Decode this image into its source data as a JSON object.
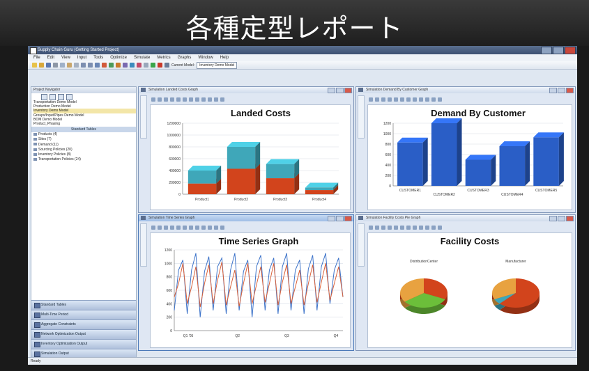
{
  "hero": {
    "title": "各種定型レポート"
  },
  "window": {
    "title": "Supply Chain Guru (Getting Started Project)"
  },
  "menu": [
    "File",
    "Edit",
    "View",
    "Input",
    "Tools",
    "Optimize",
    "Simulate",
    "Metrics",
    "Graphs",
    "Window",
    "Help"
  ],
  "toolbar": {
    "current_model_label": "Current Model:",
    "current_model_value": "Inventory Demo Model"
  },
  "navigator": {
    "title": "Project Navigator",
    "models": [
      "Transportation Demo Model",
      "Production Demo Model",
      "Inventory Demo Model",
      "Groups/Input/Pipes Demo Model",
      "BOM Demo Model",
      "Product_Phasing"
    ],
    "selected_index": 2,
    "standard_tables_label": "Standard Tables",
    "tables": [
      "Products (4)",
      "Sites (7)",
      "Demand (11)",
      "Sourcing Policies (20)",
      "Inventory Policies (8)",
      "Transportation Policies (24)"
    ],
    "buttons": [
      "Standard Tables",
      "Multi-Time Period",
      "Aggregate Constraints",
      "Network Optimization Output",
      "Inventory Optimization Output",
      "Simulation Output"
    ]
  },
  "windows": {
    "landed": {
      "title": "Simulation Landed Costs Graph"
    },
    "demand": {
      "title": "Simulation Demand By Customer Graph"
    },
    "timeseries": {
      "title": "Simulation Time Series Graph"
    },
    "facility": {
      "title": "Simulation Facility Costs Pie Graph"
    }
  },
  "status": "Ready",
  "colors": {
    "teal": "#3fa7b9",
    "red": "#d2441c",
    "blue": "#2a5ec6",
    "orange": "#e8a240",
    "green": "#6cbf3a"
  },
  "chart_data": [
    {
      "type": "bar",
      "title": "Landed Costs",
      "categories": [
        "Product1",
        "Product2",
        "Product3",
        "Product4"
      ],
      "series": [
        {
          "values": [
            180000,
            430000,
            270000,
            70000
          ]
        },
        {
          "values": [
            220000,
            370000,
            240000,
            40000
          ]
        }
      ],
      "yticks": [
        "0",
        "200000",
        "400000",
        "600000",
        "800000",
        "1000000",
        "1200000"
      ],
      "ylim": [
        0,
        1200000
      ],
      "grid": true
    },
    {
      "type": "bar",
      "title": "Demand By Customer",
      "categories": [
        "CUSTOMER1",
        "CUSTOMER2",
        "CUSTOMER3",
        "CUSTOMER4",
        "CUSTOMER5"
      ],
      "values": [
        830,
        1200,
        500,
        760,
        930
      ],
      "yticks": [
        "0",
        "200",
        "400",
        "600",
        "800",
        "1000",
        "1200"
      ],
      "ylim": [
        0,
        1200
      ],
      "grid": true
    },
    {
      "type": "line",
      "title": "Time Series Graph",
      "xticks": [
        "Q1 '05",
        "Q2",
        "Q3",
        "Q4"
      ],
      "yticks": [
        "0",
        "200",
        "400",
        "600",
        "800",
        "1000",
        "1200"
      ],
      "ylim": [
        0,
        1200
      ],
      "series": [
        {
          "values": [
            300,
            900,
            1050,
            250,
            900,
            1150,
            200,
            880,
            1100,
            300,
            950,
            1080,
            250,
            900,
            1150,
            300,
            880,
            1050,
            200,
            950,
            1120,
            300,
            900,
            1080,
            250,
            950,
            1150,
            300,
            900,
            1050,
            250,
            920,
            1120,
            300,
            950,
            1150,
            400,
            900,
            1080,
            500
          ]
        },
        {
          "values": [
            500,
            700,
            1000,
            400,
            650,
            950,
            350,
            700,
            980,
            400,
            750,
            1020,
            380,
            650,
            900,
            360,
            700,
            1000,
            400,
            680,
            950,
            420,
            700,
            1000,
            380,
            720,
            980,
            400,
            650,
            900,
            380,
            700,
            980,
            420,
            720,
            1000,
            450,
            700,
            950,
            500
          ]
        }
      ],
      "grid": true
    },
    {
      "type": "pie",
      "title": "Facility Costs",
      "pies": [
        {
          "label": "DistributionCenter",
          "slices": [
            {
              "value": 0.32,
              "color": "#d2441c"
            },
            {
              "value": 0.33,
              "color": "#6cbf3a"
            },
            {
              "value": 0.35,
              "color": "#e8a240"
            }
          ]
        },
        {
          "label": "Manufacturer",
          "slices": [
            {
              "value": 0.62,
              "color": "#d2441c"
            },
            {
              "value": 0.06,
              "color": "#3fa7b9"
            },
            {
              "value": 0.32,
              "color": "#e8a240"
            }
          ]
        }
      ]
    }
  ]
}
